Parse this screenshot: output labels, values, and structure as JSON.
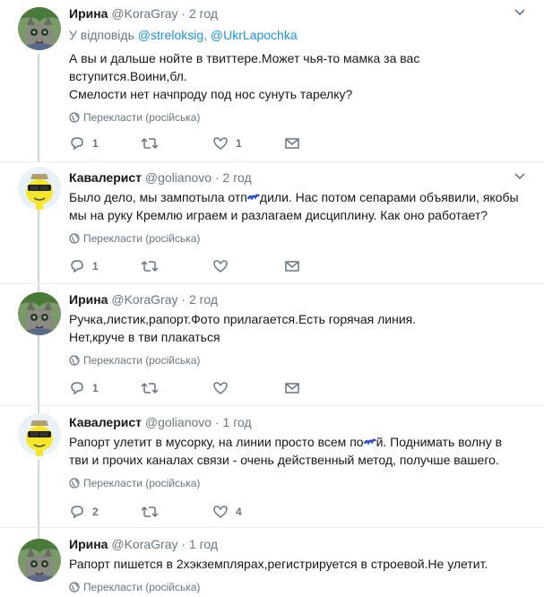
{
  "tweets": [
    {
      "name": "Ирина",
      "handle": "@KoraGray",
      "dot": "·",
      "time": "2 год",
      "reply_prefix": "У відповідь",
      "mention1": "@streloksig",
      "mention_sep": ",",
      "mention2": "@UkrLapochka",
      "lines": [
        "А вы и дальше нойте в твиттере.Может чья-то мамка за вас",
        "вступится.Воини,бл.",
        "Смелости нет начпроду под нос сунуть тарелку?"
      ],
      "translate": "Перекласти (російська)",
      "replies": "1",
      "retweets": "",
      "likes": "1"
    },
    {
      "name": "Кавалерист",
      "handle": "@golianovo",
      "dot": "·",
      "time": "2 год",
      "lines_a": "Было дело, мы зампотыла отп",
      "lines_b": "дили. Нас потом сепарами объявили, якобы",
      "line2": "мы на руку Кремлю играем и разлагаем дисциплину. Как оно работает?",
      "translate": "Перекласти (російська)",
      "replies": "1",
      "retweets": "",
      "likes": ""
    },
    {
      "name": "Ирина",
      "handle": "@KoraGray",
      "dot": "·",
      "time": "2 год",
      "lines": [
        "Ручка,листик,рапорт.Фото прилагается.Есть горячая линия.",
        "Нет,круче в тви плакаться"
      ],
      "translate": "Перекласти (російська)",
      "replies": "1",
      "retweets": "",
      "likes": ""
    },
    {
      "name": "Кавалерист",
      "handle": "@golianovo",
      "dot": "·",
      "time": "1 год",
      "line1a": "Рапорт улетит в мусорку, на линии просто всем по",
      "line1b": "й. Поднимать волну в",
      "line2": "тви и прочих каналах связи - очень действенный метод, получше вашего.",
      "translate": "Перекласти (російська)",
      "replies": "2",
      "retweets": "",
      "likes": "4"
    },
    {
      "name": "Ирина",
      "handle": "@KoraGray",
      "dot": "·",
      "time": "1 год",
      "lines": [
        "Рапорт пишется в 2хэкземплярах,регистрируется в строевой.Не улетит."
      ],
      "translate": "Перекласти (російська)"
    }
  ],
  "icons": {
    "reply": "reply-icon",
    "retweet": "retweet-icon",
    "like": "heart-icon",
    "dm": "envelope-icon",
    "translate": "globe-icon",
    "caret": "chevron-down-icon"
  },
  "colors": {
    "link": "#1b95e0",
    "secondary": "#657786",
    "thread": "#ccd6dd",
    "separator": "#e6ecf0"
  }
}
